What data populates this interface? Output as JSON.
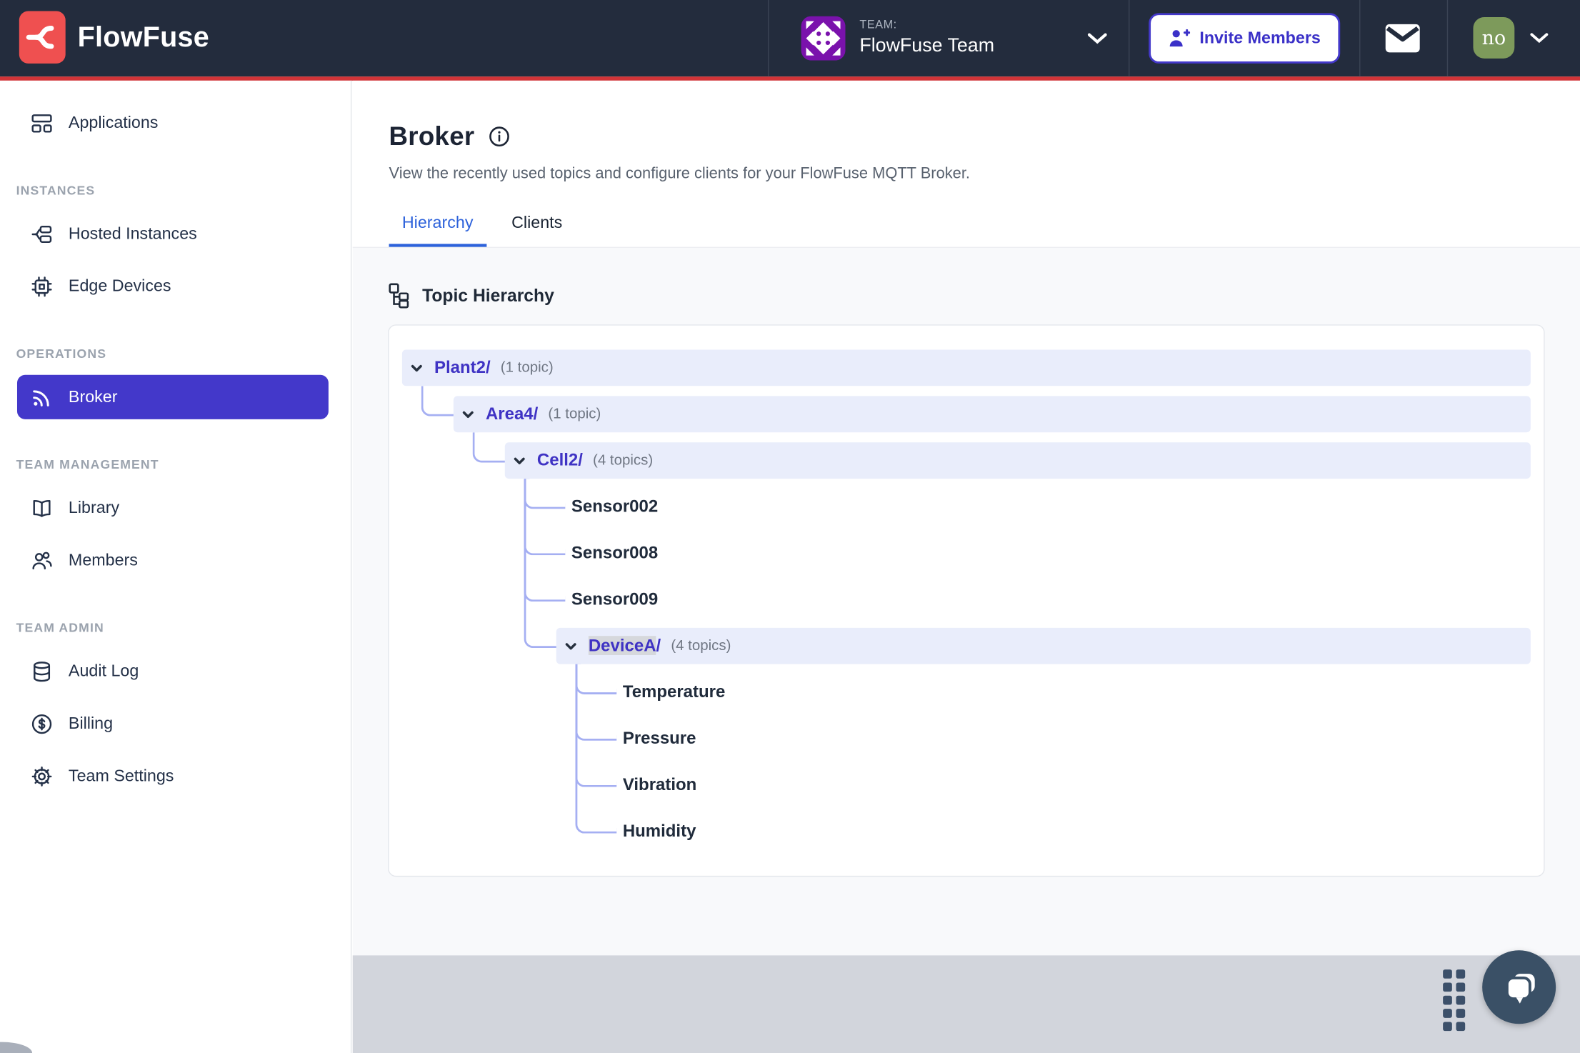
{
  "navbar": {
    "brand": "FlowFuse",
    "team_label": "TEAM:",
    "team_name": "FlowFuse Team",
    "invite_label": "Invite Members",
    "avatar_text": "no",
    "icons": [
      "flowfuse-logo-icon",
      "team-avatar-identicon",
      "chevron-down-icon",
      "user-plus-icon",
      "envelope-icon"
    ]
  },
  "sidebar": {
    "sections": [
      {
        "label": "",
        "items": [
          {
            "label": "Applications",
            "icon": "applications-icon",
            "active": false
          }
        ]
      },
      {
        "label": "INSTANCES",
        "items": [
          {
            "label": "Hosted Instances",
            "icon": "hosted-instances-icon",
            "active": false
          },
          {
            "label": "Edge Devices",
            "icon": "edge-devices-icon",
            "active": false
          }
        ]
      },
      {
        "label": "OPERATIONS",
        "items": [
          {
            "label": "Broker",
            "icon": "broker-rss-icon",
            "active": true
          }
        ]
      },
      {
        "label": "TEAM MANAGEMENT",
        "items": [
          {
            "label": "Library",
            "icon": "library-book-icon",
            "active": false
          },
          {
            "label": "Members",
            "icon": "members-users-icon",
            "active": false
          }
        ]
      },
      {
        "label": "TEAM ADMIN",
        "items": [
          {
            "label": "Audit Log",
            "icon": "audit-log-database-icon",
            "active": false
          },
          {
            "label": "Billing",
            "icon": "billing-dollar-icon",
            "active": false
          },
          {
            "label": "Team Settings",
            "icon": "settings-gear-icon",
            "active": false
          }
        ]
      }
    ]
  },
  "page": {
    "title": "Broker",
    "description": "View the recently used topics and configure clients for your FlowFuse MQTT Broker.",
    "tabs": [
      {
        "label": "Hierarchy",
        "active": true
      },
      {
        "label": "Clients",
        "active": false
      }
    ]
  },
  "hierarchy": {
    "section_title": "Topic Hierarchy",
    "rows": [
      {
        "depth": 0,
        "type": "branch",
        "label": "Plant2",
        "slash": "/",
        "count": "(1 topic)",
        "highlighted": false
      },
      {
        "depth": 1,
        "type": "branch",
        "label": "Area4",
        "slash": "/",
        "count": "(1 topic)",
        "highlighted": false
      },
      {
        "depth": 2,
        "type": "branch",
        "label": "Cell2",
        "slash": "/",
        "count": "(4 topics)",
        "highlighted": false
      },
      {
        "depth": 3,
        "type": "leaf",
        "label": "Sensor002"
      },
      {
        "depth": 3,
        "type": "leaf",
        "label": "Sensor008"
      },
      {
        "depth": 3,
        "type": "leaf",
        "label": "Sensor009"
      },
      {
        "depth": 3,
        "type": "branch",
        "label": "DeviceA",
        "slash": "/",
        "count": "(4 topics)",
        "highlighted": true
      },
      {
        "depth": 4,
        "type": "leaf",
        "label": "Temperature"
      },
      {
        "depth": 4,
        "type": "leaf",
        "label": "Pressure"
      },
      {
        "depth": 4,
        "type": "leaf",
        "label": "Vibration"
      },
      {
        "depth": 4,
        "type": "leaf",
        "label": "Humidity"
      }
    ]
  },
  "footer": {
    "icons": [
      "drag-handle-dots",
      "chat-bubble-icon"
    ]
  },
  "colors": {
    "navbar_bg": "#232C3D",
    "accent_red": "#D23438",
    "logo_red": "#EF5050",
    "accent_indigo": "#4338CA",
    "tab_blue": "#2D62DB",
    "row_highlight": "#E9EDFB",
    "connector": "#A5AFF2",
    "team_avatar_purple": "#7A12AC",
    "user_avatar_green": "#7D9A5B",
    "chat_button": "#3A5066",
    "content_bg": "#F8F9FB",
    "bottom_band": "#D2D5DC"
  }
}
